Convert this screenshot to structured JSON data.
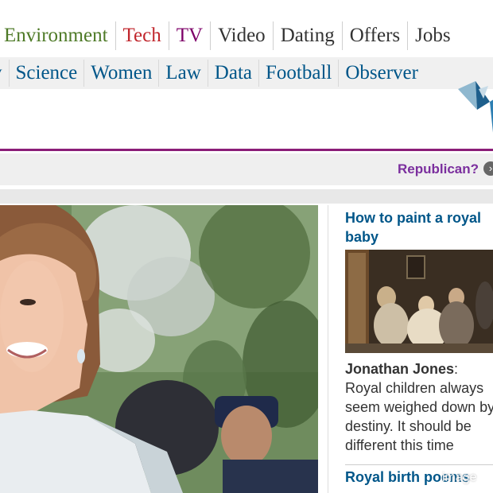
{
  "nav_primary": [
    {
      "label": "Environment",
      "color": "#4e7a27"
    },
    {
      "label": "Tech",
      "color": "#c1272d"
    },
    {
      "label": "TV",
      "color": "#7d0068"
    },
    {
      "label": "Video",
      "color": "#333333"
    },
    {
      "label": "Dating",
      "color": "#333333"
    },
    {
      "label": "Offers",
      "color": "#333333"
    },
    {
      "label": "Jobs",
      "color": "#333333"
    }
  ],
  "nav_secondary": [
    "y",
    "Science",
    "Women",
    "Law",
    "Data",
    "Football",
    "Observer"
  ],
  "strip": {
    "link": "Republican?",
    "arrow": "›"
  },
  "sidebar": {
    "headline": "How to paint a royal baby",
    "author": "Jonathan Jones",
    "text": "Royal children always seem weighed down by destiny. It should be different this time",
    "headline2": "Royal birth poems"
  },
  "watermark": "image",
  "colors": {
    "link_blue": "#005689",
    "purple": "#7b2f9e",
    "rule": "#8b1d78"
  }
}
